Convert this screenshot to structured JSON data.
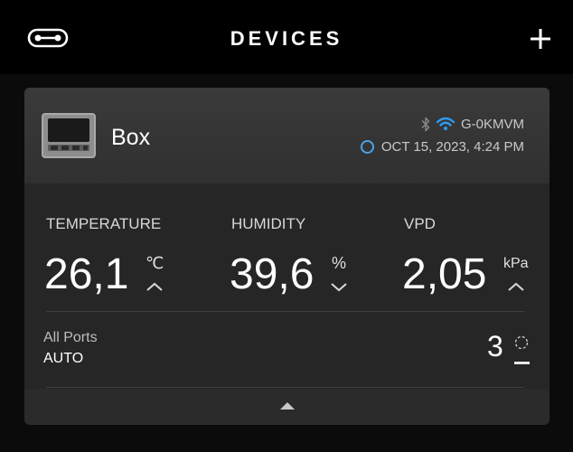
{
  "header": {
    "title": "DEVICES",
    "menu_icon": "link-toggle-icon",
    "add_icon": "plus-icon"
  },
  "device": {
    "name": "Box",
    "connection": {
      "bluetooth_icon": "bluetooth-icon",
      "wifi_icon": "wifi-icon",
      "id": "G-0KMVM"
    },
    "timestamp": "OCT 15, 2023, 4:24 PM",
    "status_color": "#4aa3e8"
  },
  "metrics": [
    {
      "label": "TEMPERATURE",
      "value": "26,1",
      "unit": "℃",
      "trend": "up"
    },
    {
      "label": "HUMIDITY",
      "value": "39,6",
      "unit": "%",
      "trend": "down"
    },
    {
      "label": "VPD",
      "value": "2,05",
      "unit": "kPa",
      "trend": "up"
    }
  ],
  "ports": {
    "label": "All Ports",
    "mode": "AUTO",
    "count": "3"
  },
  "colors": {
    "accent_blue": "#2f9bf0",
    "card_bg": "#262626",
    "page_bg": "#000000"
  }
}
